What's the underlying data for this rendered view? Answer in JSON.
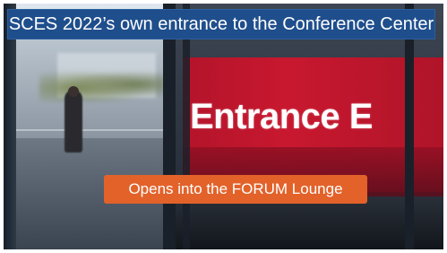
{
  "photo": {
    "title_caption": "SCES 2022’s own entrance to the Conference Center",
    "sign_text": "Entrance E",
    "bottom_caption": "Opens into the FORUM Lounge"
  },
  "colors": {
    "title_bg": "#1f4e8c",
    "bottom_caption_bg": "#e2622a",
    "sign_red": "#c8182f"
  }
}
